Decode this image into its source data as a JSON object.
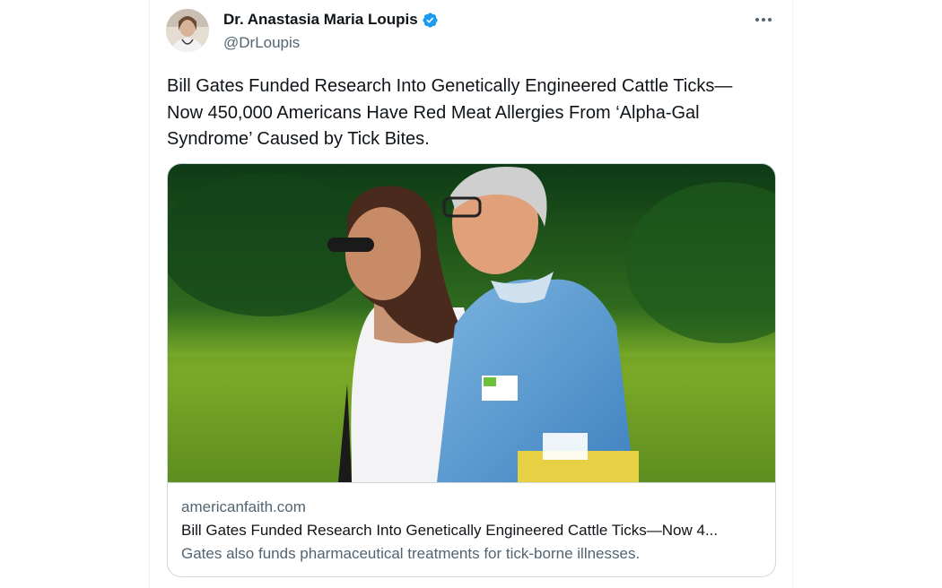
{
  "author": {
    "name": "Dr. Anastasia Maria Loupis",
    "handle": "@DrLoupis",
    "verified": true,
    "verified_color": "#1d9bf0"
  },
  "more_menu_icon": "more-horizontal-icon",
  "tweet": {
    "line1": "Bill Gates Funded Research Into Genetically Engineered Cattle Ticks—",
    "line2": "Now 450,000 Americans Have Red Meat Allergies From ‘Alpha-Gal",
    "line3": "Syndrome’ Caused by Tick Bites."
  },
  "link_card": {
    "domain": "americanfaith.com",
    "title": "Bill Gates Funded Research Into Genetically Engineered Cattle Ticks—Now 4...",
    "description": "Gates also funds pharmaceutical treatments for tick-borne illnesses."
  },
  "colors": {
    "text_primary": "#0f1419",
    "text_secondary": "#536471",
    "border": "#cfd9de"
  }
}
